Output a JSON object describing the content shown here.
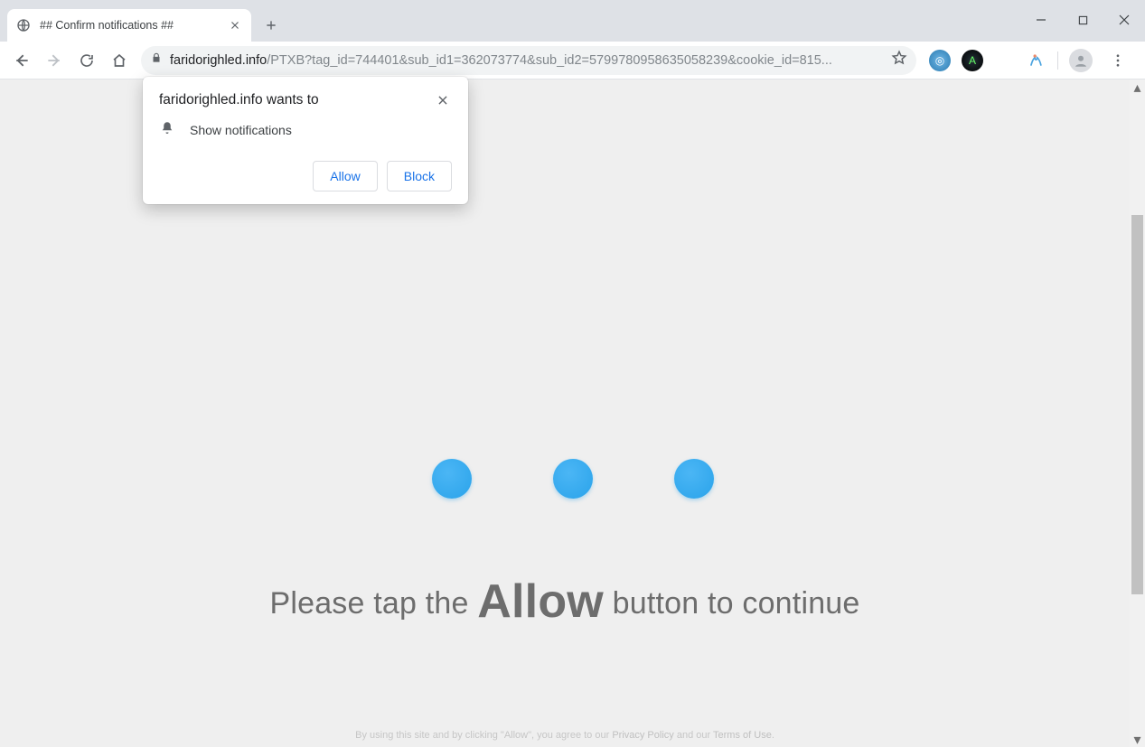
{
  "tab": {
    "title": "## Confirm notifications ##"
  },
  "url": {
    "host": "faridorighled.info",
    "path": "/PTXB?tag_id=744401&sub_id1=362073774&sub_id2=579978095863505​8239&cookie_id=815..."
  },
  "permission": {
    "title": "faridorighled.info wants to",
    "item": "Show notifications",
    "allow": "Allow",
    "block": "Block"
  },
  "page": {
    "headline_pre": "Please tap the ",
    "headline_em": "Allow",
    "headline_post": " button to continue",
    "fineprint_pre": "By using this site and by clicking \"Allow\", you agree to our ",
    "fineprint_link1": "Privacy Policy",
    "fineprint_mid": " and our ",
    "fineprint_link2": "Terms of Use",
    "fineprint_end": "."
  }
}
